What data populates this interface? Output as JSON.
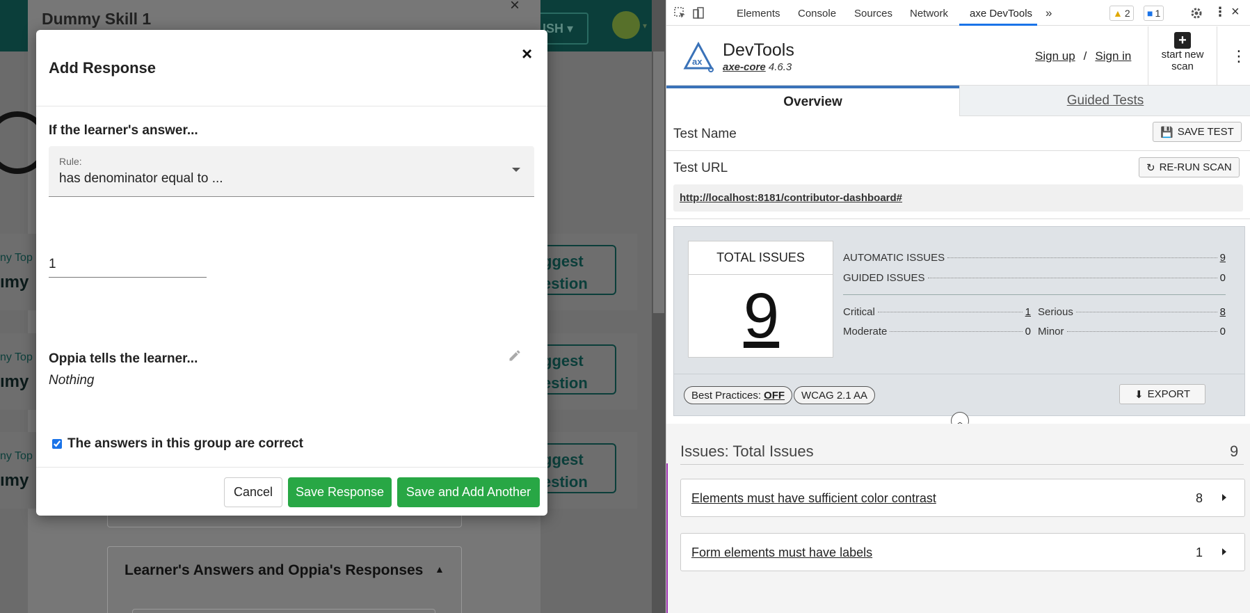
{
  "app": {
    "modal_behind_title": "Dummy Skill 1",
    "lang_label": "ISH",
    "topic_rows": [
      {
        "topic": "ny Top",
        "name": "ımy",
        "suggest_l1": "ggest",
        "suggest_l2": "estion"
      },
      {
        "topic": "ny Top",
        "name": "ımy",
        "suggest_l1": "ggest",
        "suggest_l2": "estion"
      },
      {
        "topic": "ny Top",
        "name": "ımy",
        "suggest_l1": "ggest",
        "suggest_l2": "estion"
      }
    ],
    "answers_card_title": "Learner's Answers and Oppia's Responses"
  },
  "modal": {
    "title": "Add Response",
    "close_glyph": "×",
    "if_label": "If the learner's answer...",
    "rule_label": "Rule:",
    "rule_value": "has denominator equal to ...",
    "input_value": "1",
    "tells_label": "Oppia tells the learner...",
    "feedback_value": "Nothing",
    "correct_checkbox_label": "The answers in this group are correct",
    "correct_checked": true,
    "cancel_label": "Cancel",
    "save_label": "Save Response",
    "save_add_label": "Save and Add Another"
  },
  "devtools": {
    "tabs": [
      "Elements",
      "Console",
      "Sources",
      "Network",
      "axe DevTools"
    ],
    "active_tab": "axe DevTools",
    "more_glyph": "»",
    "warnings": "2",
    "messages": "1",
    "axe": {
      "product": "DevTools",
      "core_label": "axe-core",
      "core_version": "4.6.3",
      "sign_up": "Sign up",
      "sep": "/",
      "sign_in": "Sign in",
      "new_scan_l1": "start new",
      "new_scan_l2": "scan",
      "tab_overview": "Overview",
      "tab_guided": "Guided Tests",
      "test_name_label": "Test Name",
      "save_test": "SAVE TEST",
      "test_url_label": "Test URL",
      "rerun": "RE-RUN SCAN",
      "url": "http://localhost:8181/contributor-dashboard#",
      "total_issues_label": "TOTAL ISSUES",
      "total_issues": "9",
      "automatic_label": "AUTOMATIC ISSUES",
      "automatic": "9",
      "guided_label": "GUIDED ISSUES",
      "guided": "0",
      "critical_label": "Critical",
      "critical": "1",
      "serious_label": "Serious",
      "serious": "8",
      "moderate_label": "Moderate",
      "moderate": "0",
      "minor_label": "Minor",
      "minor": "0",
      "best_practices_label": "Best Practices:",
      "best_practices_value": "OFF",
      "wcag": "WCAG 2.1 AA",
      "export": "EXPORT",
      "issues_header": "Issues: Total Issues",
      "issues_count": "9",
      "issues": [
        {
          "title": "Elements must have sufficient color contrast",
          "count": "8"
        },
        {
          "title": "Form elements must have labels",
          "count": "1"
        }
      ]
    }
  }
}
